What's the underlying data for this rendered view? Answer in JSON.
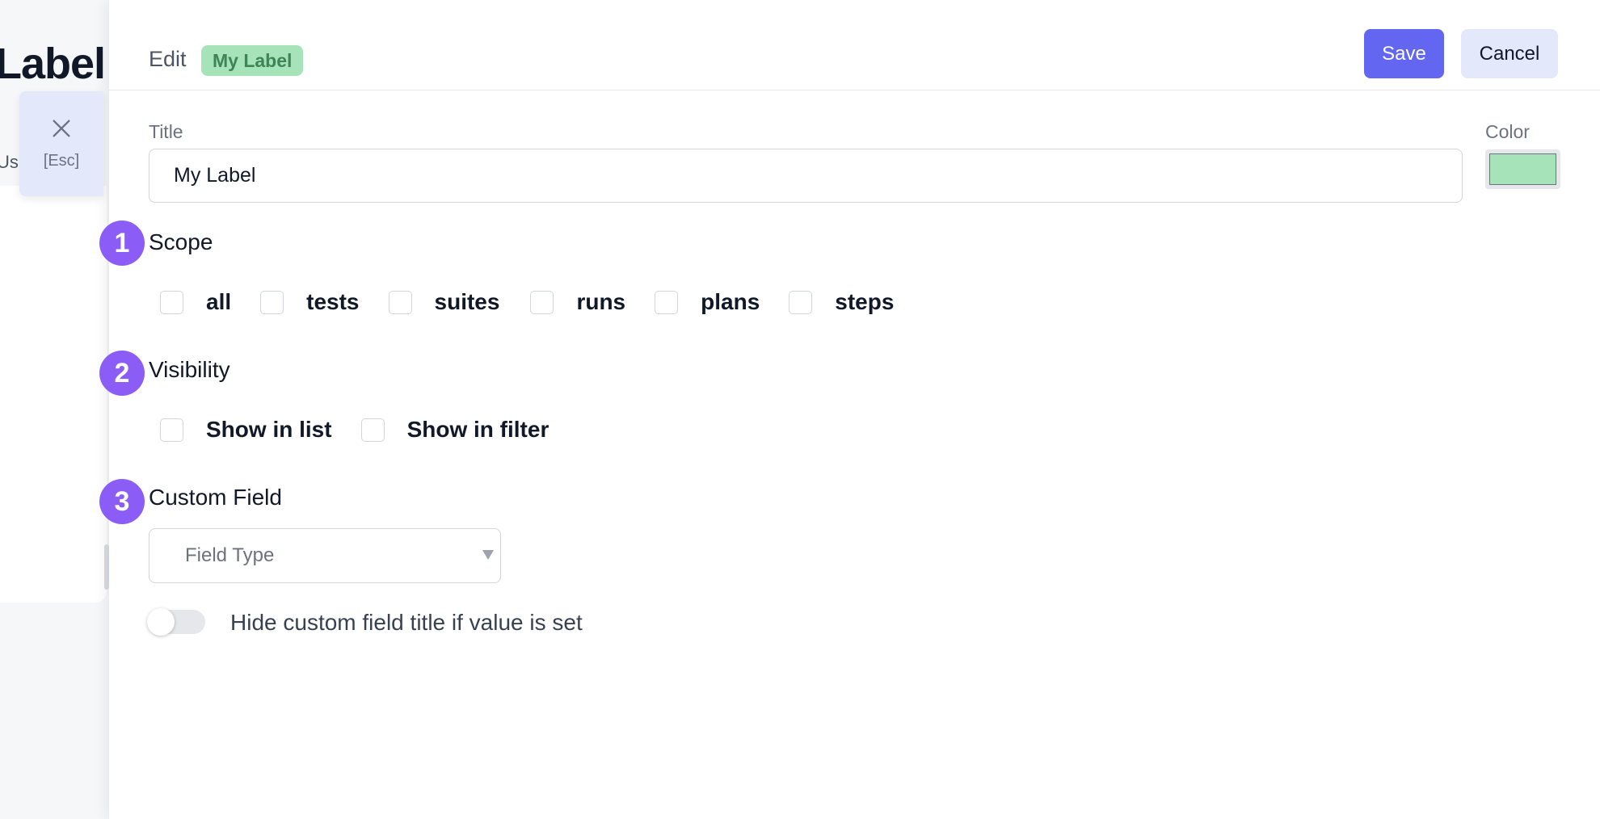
{
  "background": {
    "page_title": "Label",
    "sub_text": "Us",
    "close_button": {
      "icon": "close-icon",
      "shortcut": "[Esc]"
    }
  },
  "header": {
    "edit_label": "Edit",
    "label_badge": "My Label",
    "save_label": "Save",
    "cancel_label": "Cancel",
    "accent_color": "#6366f1"
  },
  "form": {
    "title_label": "Title",
    "title_value": "My Label",
    "color_label": "Color",
    "color_value": "#a7e3b9",
    "steps": [
      "1",
      "2",
      "3"
    ],
    "scope": {
      "title": "Scope",
      "options": [
        {
          "label": "all",
          "checked": false
        },
        {
          "label": "tests",
          "checked": false
        },
        {
          "label": "suites",
          "checked": false
        },
        {
          "label": "runs",
          "checked": false
        },
        {
          "label": "plans",
          "checked": false
        },
        {
          "label": "steps",
          "checked": false
        }
      ]
    },
    "visibility": {
      "title": "Visibility",
      "options": [
        {
          "label": "Show in list",
          "checked": false
        },
        {
          "label": "Show in filter",
          "checked": false
        }
      ]
    },
    "custom_field": {
      "title": "Custom Field",
      "select_placeholder": "Field Type",
      "toggle_label": "Hide custom field title if value is set",
      "toggle_on": false
    },
    "step_badge_color": "#8b5cf6"
  }
}
